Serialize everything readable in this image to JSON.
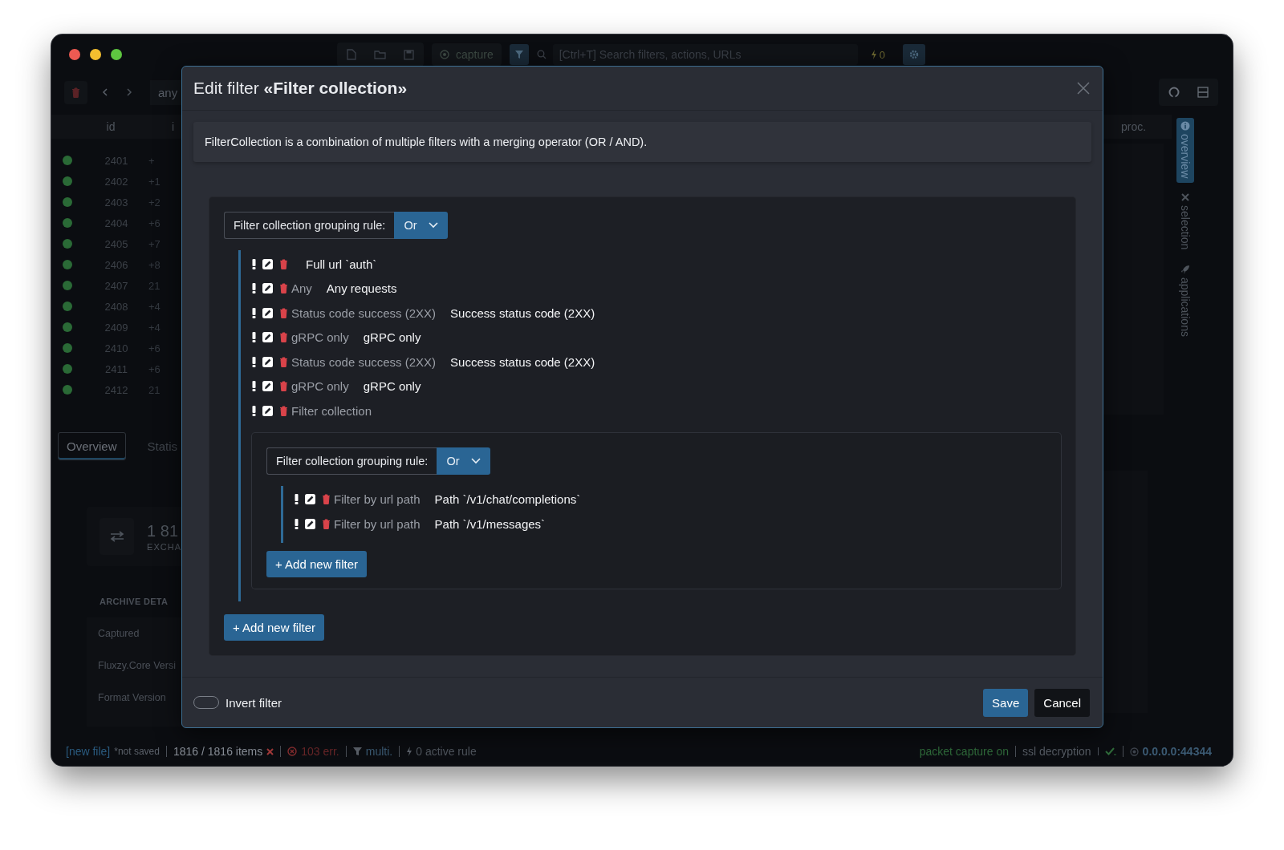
{
  "window": {
    "capture_label": "capture",
    "search_placeholder": "[Ctrl+T] Search filters, actions, URLs",
    "alert_count": "0",
    "quick_filter": "any"
  },
  "table": {
    "columns": [
      "id",
      "i"
    ],
    "right_column": "proc.",
    "rows": [
      {
        "id": "2401",
        "column_2": "+"
      },
      {
        "id": "2402",
        "column_2": "+1"
      },
      {
        "id": "2403",
        "column_2": "+2"
      },
      {
        "id": "2404",
        "column_2": "+6"
      },
      {
        "id": "2405",
        "column_2": "+7"
      },
      {
        "id": "2406",
        "column_2": "+8"
      },
      {
        "id": "2407",
        "column_2": "21"
      },
      {
        "id": "2408",
        "column_2": "+4"
      },
      {
        "id": "2409",
        "column_2": "+4"
      },
      {
        "id": "2410",
        "column_2": "+6"
      },
      {
        "id": "2411",
        "column_2": "+6"
      },
      {
        "id": "2412",
        "column_2": "21"
      }
    ]
  },
  "detail_tabs": [
    {
      "label": "Overview",
      "selected": true
    },
    {
      "label": "Statis",
      "selected": false
    }
  ],
  "summary": {
    "value": "1 81",
    "caption": "EXCHA"
  },
  "archive": {
    "title": "ARCHIVE DETA",
    "fields": [
      "Captured",
      "Fluxzy.Core Versi",
      "Format Version"
    ]
  },
  "side_tabs": [
    {
      "label": "overview",
      "selected": true
    },
    {
      "label": "selection",
      "selected": false
    },
    {
      "label": "applications",
      "selected": false
    }
  ],
  "status_bar": {
    "left": [
      {
        "kind": "file",
        "text": "[new file]",
        "note": "*not saved"
      },
      {
        "kind": "count",
        "text": "1816 / 1816 items"
      },
      {
        "kind": "errors",
        "text": "103 err."
      },
      {
        "kind": "filter",
        "text": "multi."
      },
      {
        "kind": "rules",
        "text": "0 active rule"
      }
    ],
    "right": [
      {
        "kind": "capture",
        "text": "packet capture on"
      },
      {
        "kind": "ssl",
        "text": "ssl decryption"
      },
      {
        "kind": "address",
        "text": "0.0.0.0:44344"
      }
    ]
  },
  "dialog": {
    "title": "Edit filter **«Filter collection»**",
    "description": "FilterCollection is a combination of multiple filters with a merging operator (OR / AND).",
    "root": {
      "rule_label": "Filter collection grouping rule:",
      "rule": "Or",
      "add_label": "+ Add new filter",
      "children": [
        {
          "kind": "filter",
          "description": "Full url `auth`"
        },
        {
          "kind": "filter",
          "label": "Any",
          "description": "Any requests"
        },
        {
          "kind": "filter",
          "label": "Status code success (2XX)",
          "description": "Success status code (2XX)"
        },
        {
          "kind": "filter",
          "label": "gRPC only",
          "description": "gRPC only"
        },
        {
          "kind": "filter",
          "label": "Status code success (2XX)",
          "description": "Success status code (2XX)"
        },
        {
          "kind": "filter",
          "label": "gRPC only",
          "description": "gRPC only"
        },
        {
          "kind": "collection",
          "label": "Filter collection",
          "rule_label": "Filter collection grouping rule:",
          "rule": "Or",
          "add_label": "+ Add new filter",
          "children": [
            {
              "kind": "filter",
              "label": "Filter by url path",
              "description": "Path `/v1/chat/completions`"
            },
            {
              "kind": "filter",
              "label": "Filter by url path",
              "description": "Path `/v1/messages`"
            }
          ]
        }
      ]
    },
    "invert": {
      "label": "Invert filter",
      "on": false
    },
    "buttons": [
      {
        "kind": "primary",
        "label": "Save"
      },
      {
        "kind": "secondary",
        "label": "Cancel"
      }
    ]
  }
}
